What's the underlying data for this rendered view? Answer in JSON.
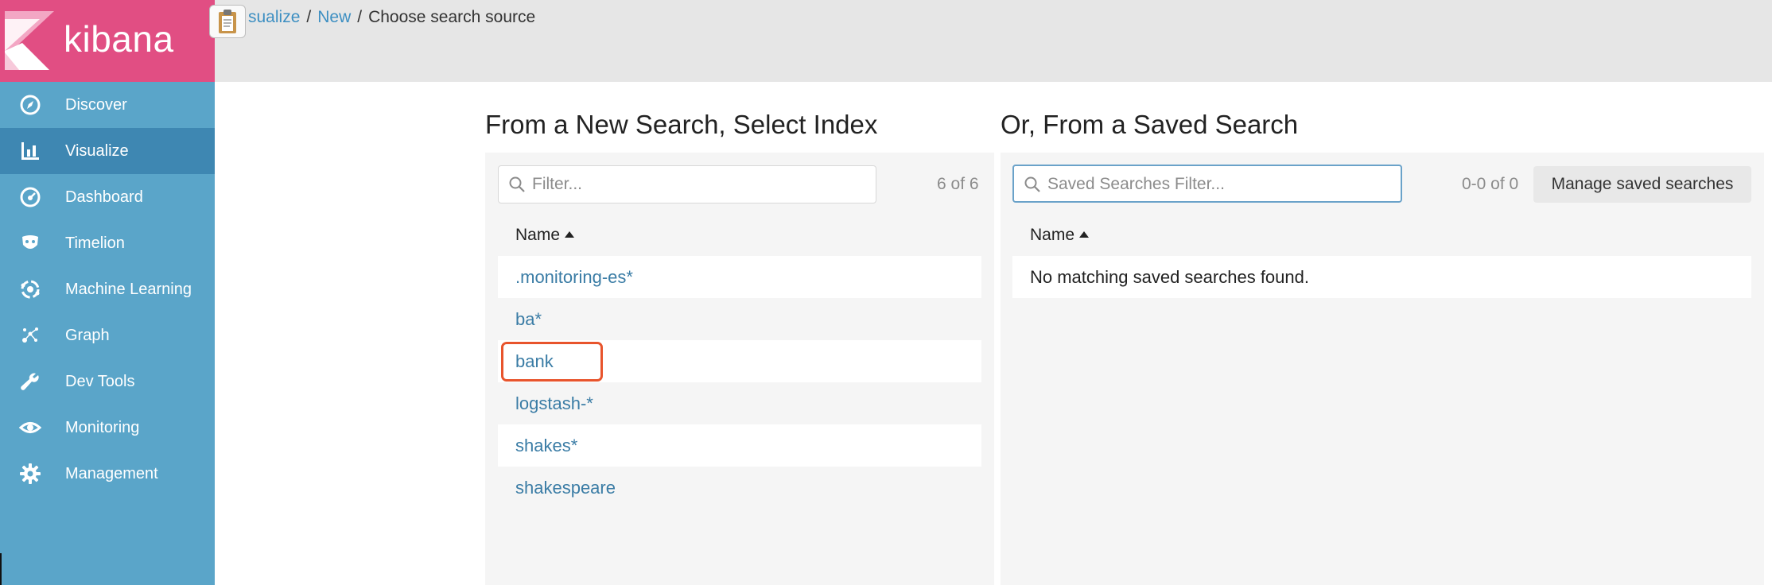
{
  "app": {
    "name": "kibana"
  },
  "sidebar": {
    "items": [
      {
        "label": "Discover",
        "icon": "compass-icon"
      },
      {
        "label": "Visualize",
        "icon": "bar-chart-icon",
        "active": true
      },
      {
        "label": "Dashboard",
        "icon": "dashboard-gauge-icon"
      },
      {
        "label": "Timelion",
        "icon": "timelion-mask-icon"
      },
      {
        "label": "Machine Learning",
        "icon": "machine-learning-icon"
      },
      {
        "label": "Graph",
        "icon": "graph-icon"
      },
      {
        "label": "Dev Tools",
        "icon": "wrench-icon"
      },
      {
        "label": "Monitoring",
        "icon": "eye-icon"
      },
      {
        "label": "Management",
        "icon": "gear-icon"
      }
    ]
  },
  "breadcrumb": {
    "items": [
      {
        "label": "sualize",
        "link": true
      },
      {
        "label": "New",
        "link": true
      },
      {
        "label": "Choose search source",
        "link": false
      }
    ],
    "separator": "/"
  },
  "left_panel": {
    "heading": "From a New Search, Select Index",
    "filter_placeholder": "Filter...",
    "count": "6 of 6",
    "column_header": "Name",
    "rows": [
      ".monitoring-es*",
      "ba*",
      "bank",
      "logstash-*",
      "shakes*",
      "shakespeare"
    ],
    "highlighted_row": "bank"
  },
  "right_panel": {
    "heading": "Or, From a Saved Search",
    "filter_placeholder": "Saved Searches Filter...",
    "count": "0-0 of 0",
    "manage_button": "Manage saved searches",
    "column_header": "Name",
    "empty_message": "No matching saved searches found."
  },
  "colors": {
    "brand_pink": "#e14e83",
    "sidebar_blue": "#5aa5c9",
    "sidebar_active": "#3e87b2",
    "link_blue": "#3a7ca5",
    "highlight_red": "#e8542c"
  }
}
